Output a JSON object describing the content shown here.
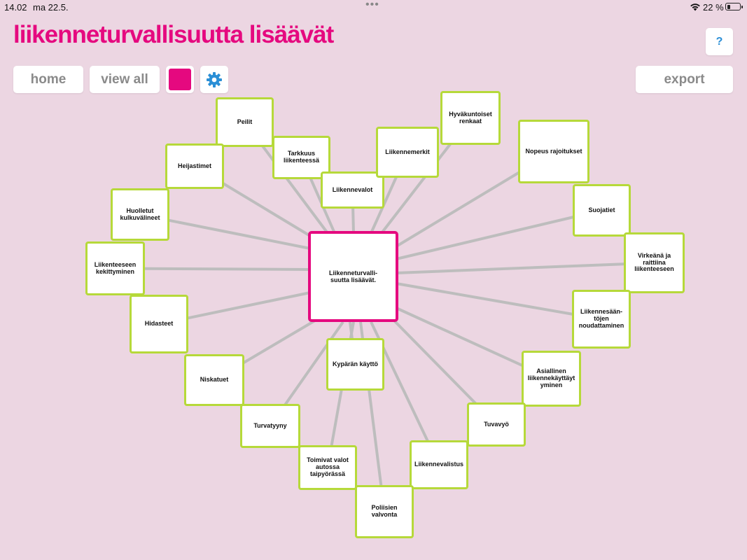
{
  "status": {
    "time": "14.02",
    "date": "ma 22.5.",
    "battery": "22 %"
  },
  "title": "liikenneturvallisuutta lisäävät",
  "toolbar": {
    "home": "home",
    "view_all": "view all",
    "export": "export",
    "help": "?"
  },
  "colors": {
    "accent": "#e5097f",
    "node_border": "#b6d93a",
    "link": "#bdbdbd",
    "background": "#ecd6e2",
    "gear": "#2b8fd6"
  },
  "center": {
    "label": "Liikenneturvalli-\nsuutta lisäävät."
  },
  "nodes": [
    {
      "label": "Peilit"
    },
    {
      "label": "Tarkkuus liikenteessä"
    },
    {
      "label": "Liikennevalot"
    },
    {
      "label": "Liikennemerkit"
    },
    {
      "label": "Hyväkuntoiset renkaat"
    },
    {
      "label": "Nopeus rajoitukset"
    },
    {
      "label": "Heijastimet"
    },
    {
      "label": "Huolletut kulkuvälineet"
    },
    {
      "label": "Liikenteeseen kekittyminen"
    },
    {
      "label": "Suojatiet"
    },
    {
      "label": "Virkeänä ja raittiina liikenteeseen"
    },
    {
      "label": "Hidasteet"
    },
    {
      "label": "Liikennesään-töjen noudattaminen"
    },
    {
      "label": "Niskatuet"
    },
    {
      "label": "Kypärän käyttö"
    },
    {
      "label": "Asiallinen liikennekäyttäyt yminen"
    },
    {
      "label": "Turvatyyny"
    },
    {
      "label": "Tuvavyö"
    },
    {
      "label": "Toimivat valot autossa taipyörässä"
    },
    {
      "label": "Liikennevalistus"
    },
    {
      "label": "Poliisien valvonta"
    }
  ]
}
